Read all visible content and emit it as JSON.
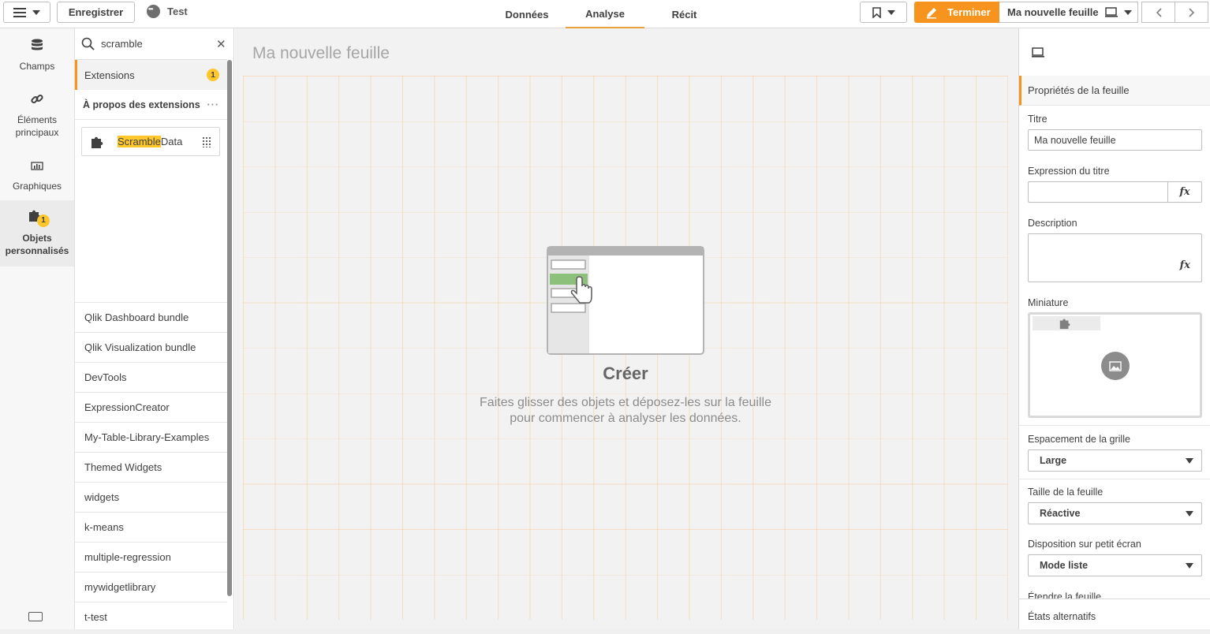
{
  "topbar": {
    "save_label": "Enregistrer",
    "app_name": "Test",
    "tabs": [
      {
        "label": "Données",
        "active": false
      },
      {
        "label": "Analyse",
        "active": true
      },
      {
        "label": "Récit",
        "active": false
      }
    ],
    "edit_label": "Terminer",
    "sheet_name": "Ma nouvelle feuille",
    "accent": "#f7941d"
  },
  "rail": {
    "items": [
      {
        "label": "Champs",
        "icon": "database-icon"
      },
      {
        "label": "Éléments principaux",
        "icon": "link-icon"
      },
      {
        "label": "Graphiques",
        "icon": "bar-chart-icon"
      },
      {
        "label": "Objets personnalisés",
        "icon": "puzzle-icon",
        "badge": "1",
        "active": true
      }
    ]
  },
  "assets": {
    "search_value": "scramble",
    "section_label": "Extensions",
    "section_badge": "1",
    "about_label": "À propos des extensions",
    "result": {
      "highlight": "Scramble",
      "rest": "Data"
    },
    "bundles": [
      "Qlik Dashboard bundle",
      "Qlik Visualization bundle",
      "DevTools",
      "ExpressionCreator",
      "My-Table-Library-Examples",
      "Themed Widgets",
      "widgets",
      "k-means",
      "multiple-regression",
      "mywidgetlibrary",
      "t-test"
    ]
  },
  "canvas": {
    "sheet_title": "Ma nouvelle feuille",
    "create_title": "Créer",
    "create_line1": "Faites glisser des objets et déposez-les sur la feuille",
    "create_line2": "pour commencer à analyser les données."
  },
  "props": {
    "header": "Propriétés de la feuille",
    "title_label": "Titre",
    "title_value": "Ma nouvelle feuille",
    "title_expr_label": "Expression du titre",
    "title_expr_value": "",
    "fx": "fx",
    "description_label": "Description",
    "thumbnail_label": "Miniature",
    "grid_label": "Espacement de la grille",
    "grid_value": "Large",
    "size_label": "Taille de la feuille",
    "size_value": "Réactive",
    "small_label": "Disposition sur petit écran",
    "small_value": "Mode liste",
    "extend_label": "Étendre la feuille",
    "alt_states": "États alternatifs"
  }
}
